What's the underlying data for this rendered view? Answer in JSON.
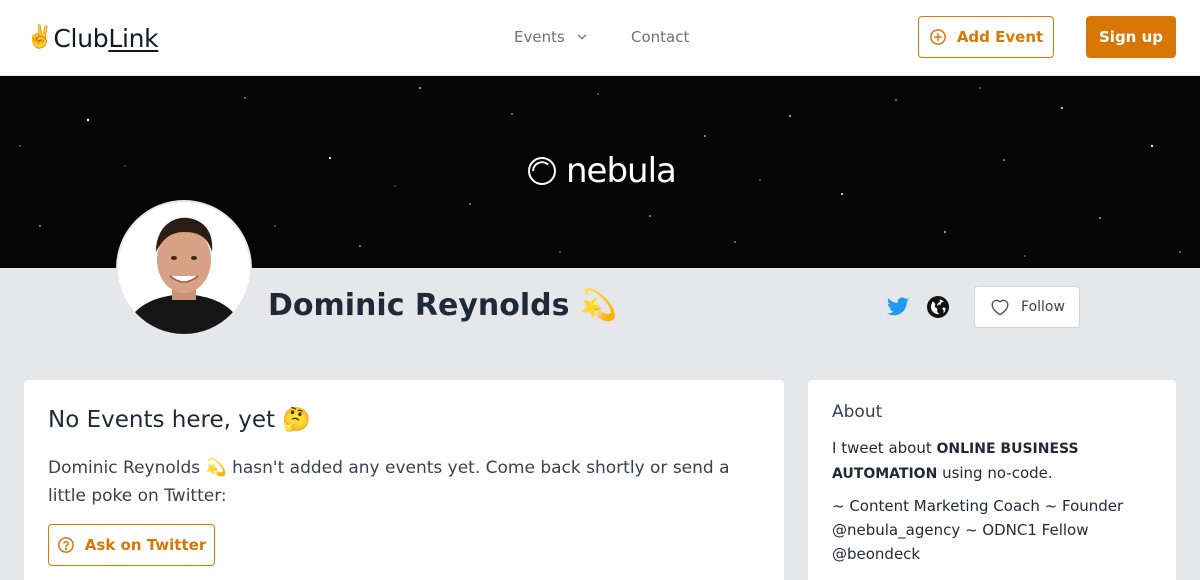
{
  "header": {
    "logo_emoji": "✌️",
    "logo_word_a": "Club",
    "logo_word_b": "Link",
    "nav": {
      "events_label": "Events",
      "contact_label": "Contact"
    },
    "add_event_label": "Add Event",
    "signup_label": "Sign up"
  },
  "banner": {
    "brand_text": "nebula"
  },
  "profile": {
    "name": "Dominic Reynolds 💫",
    "follow_label": "Follow"
  },
  "events_card": {
    "title": "No Events here, yet 🤔",
    "description": "Dominic Reynolds 💫 hasn't added any events yet. Come back shortly or send a little poke on Twitter:",
    "ask_label": "Ask on Twitter"
  },
  "about_card": {
    "title": "About",
    "line1_prefix": "I tweet about",
    "line1_bold": "ONLINE BUSINESS AUTOMATION",
    "line1_suffix": "using no-code.",
    "line2": "~ Content Marketing Coach ~ Founder @nebula_agency ~ ODNC1 Fellow @beondeck"
  },
  "colors": {
    "accent": "#d97706",
    "twitter": "#1d9bf0",
    "background": "#e6e7ea",
    "banner": "#050505"
  },
  "icons": {
    "nav_events": "chevron-down-icon",
    "add_event": "plus-circle-icon",
    "twitter": "twitter-icon",
    "website": "globe-icon",
    "follow": "heart-icon",
    "ask": "question-circle-icon"
  }
}
